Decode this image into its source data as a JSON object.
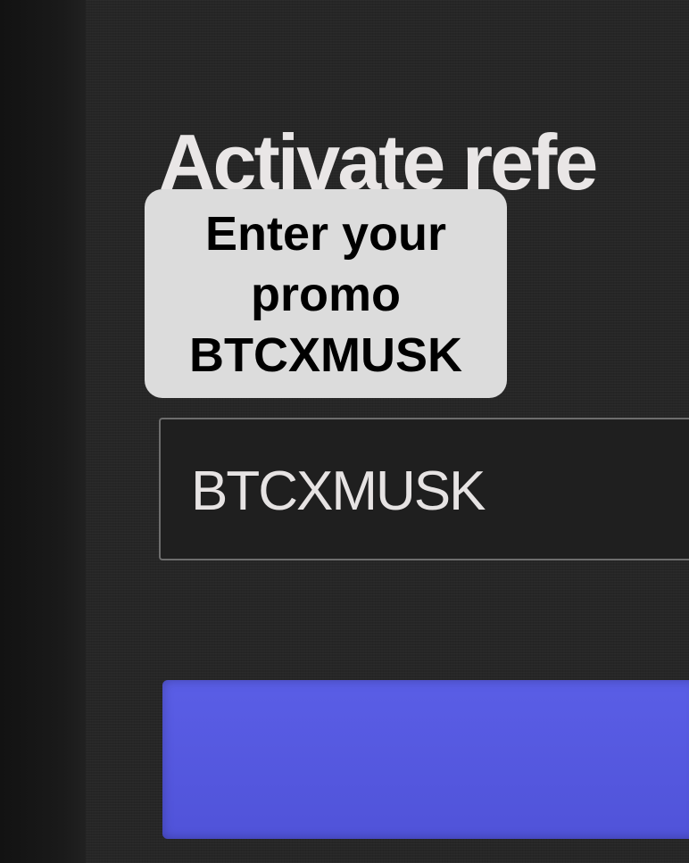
{
  "page": {
    "title": "Activate refe"
  },
  "promo_input": {
    "value": "BTCXMUSK"
  },
  "overlay": {
    "line1": "Enter your",
    "line2": "promo",
    "line3": "BTCXMUSK"
  },
  "colors": {
    "background": "#262626",
    "button": "#5659e0",
    "overlay_bg": "#dcdcdc",
    "text_light": "#e9e6e6"
  }
}
